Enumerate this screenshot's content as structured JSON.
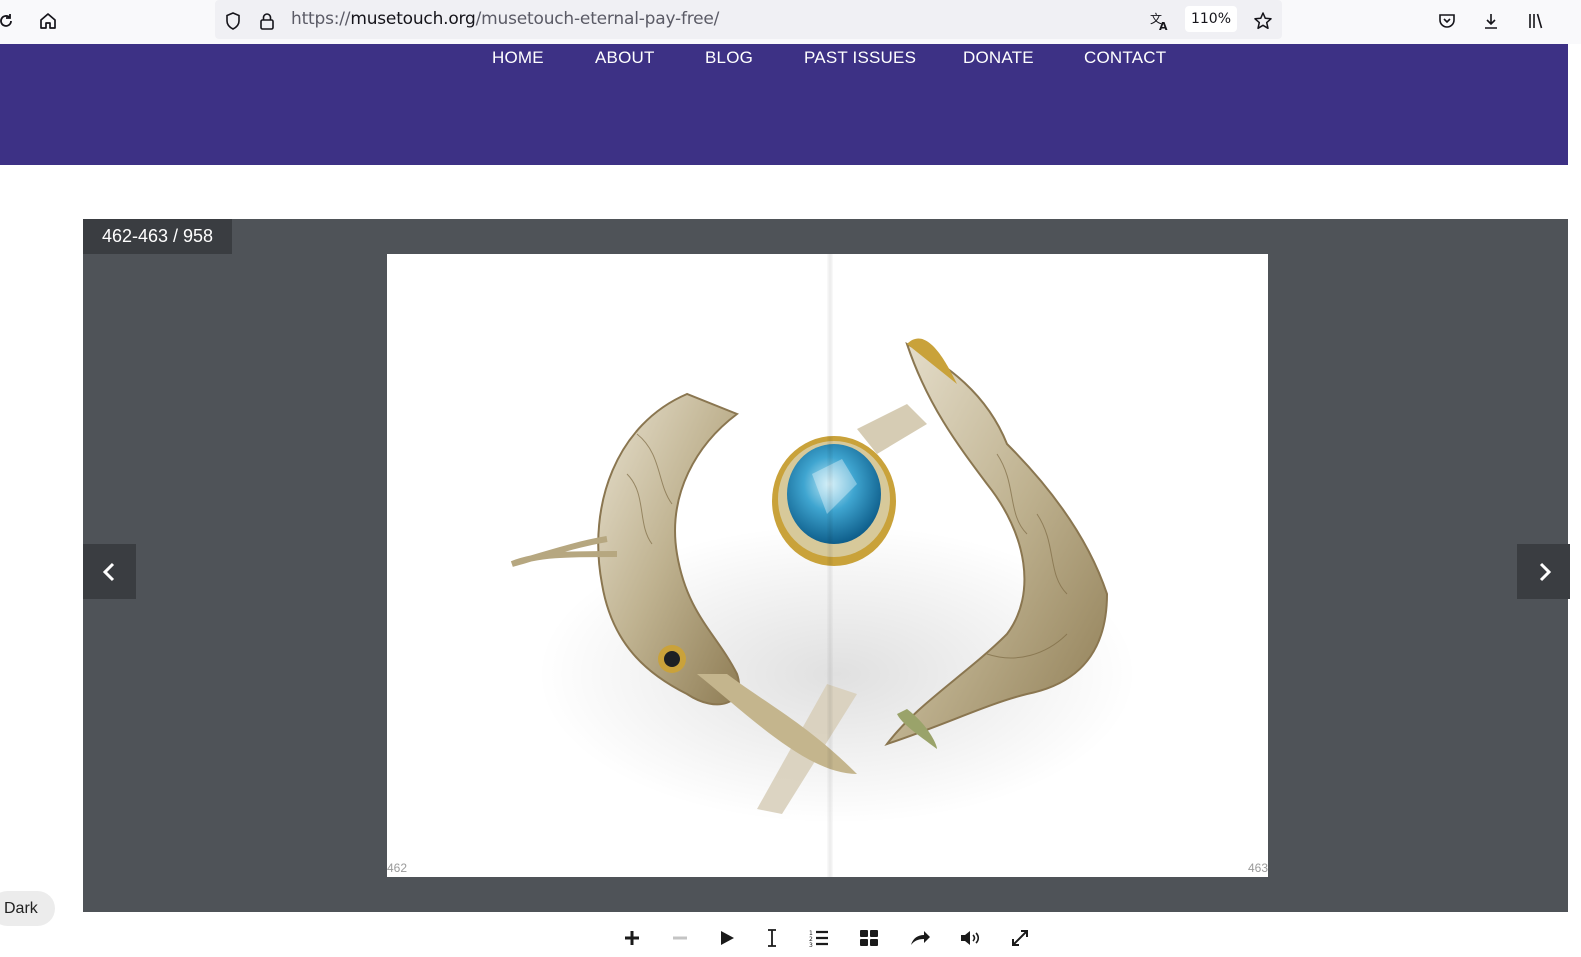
{
  "browser": {
    "url_prefix": "https://",
    "url_host": "musetouch.org",
    "url_path": "/musetouch-eternal-pay-free/",
    "zoom": "110%",
    "icons": [
      "reload-icon",
      "home-icon",
      "shield-icon",
      "lock-icon",
      "translate-icon",
      "bookmark-star-icon",
      "pocket-icon",
      "download-icon",
      "library-icon"
    ]
  },
  "site_nav": {
    "items": [
      "HOME",
      "ABOUT",
      "BLOG",
      "PAST ISSUES",
      "DONATE",
      "CONTACT"
    ],
    "color": "#3d3185"
  },
  "viewer": {
    "page_counter": "462-463 / 958",
    "left_page_number": "462",
    "right_page_number": "463",
    "image_subject": "silver fish ring with blue topaz",
    "background": "#4f5358"
  },
  "toolbar": {
    "icons": [
      "zoom-in-icon",
      "zoom-out-icon",
      "play-icon",
      "text-select-icon",
      "table-of-contents-icon",
      "thumbnails-icon",
      "share-icon",
      "sound-icon",
      "fullscreen-icon"
    ]
  },
  "dark_toggle": {
    "label": "Dark"
  }
}
